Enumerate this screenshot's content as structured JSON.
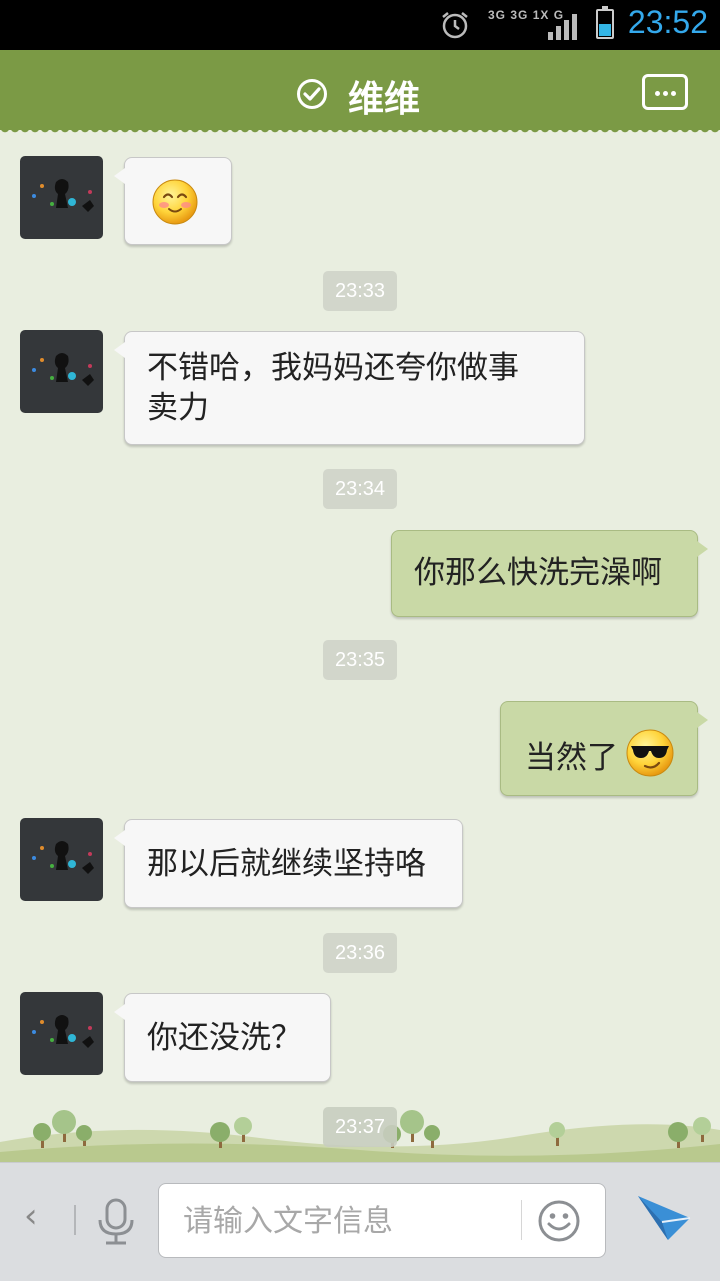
{
  "status_bar": {
    "time": "23:52",
    "network": [
      "3G",
      "3G",
      "1X",
      "G"
    ],
    "battery_level": 0.45
  },
  "header": {
    "title": "维维"
  },
  "messages": [
    {
      "side": "in",
      "emoji": "smile-blush-emoji"
    },
    {
      "timestamp": "23:33"
    },
    {
      "side": "in",
      "text_line1": "不错哈，我妈妈还夸你做事",
      "text_line2": "卖力"
    },
    {
      "timestamp": "23:34"
    },
    {
      "side": "out",
      "text": "你那么快洗完澡啊"
    },
    {
      "timestamp": "23:35"
    },
    {
      "side": "out",
      "text": "当然了",
      "emoji": "cool-sunglasses-emoji"
    },
    {
      "side": "in",
      "text": "那以后就继续坚持咯"
    },
    {
      "timestamp": "23:36"
    },
    {
      "side": "in",
      "text": "你还没洗？"
    },
    {
      "timestamp": "23:37"
    }
  ],
  "input_bar": {
    "back_label": "‹",
    "placeholder": "请输入文字信息"
  },
  "colors": {
    "header": "#7b9a45",
    "background": "#e9eee0",
    "outgoing_bubble": "#c9d9a6",
    "incoming_bubble": "#f7f7f7",
    "clock": "#34a9ec",
    "send": "#3a8fd6"
  }
}
